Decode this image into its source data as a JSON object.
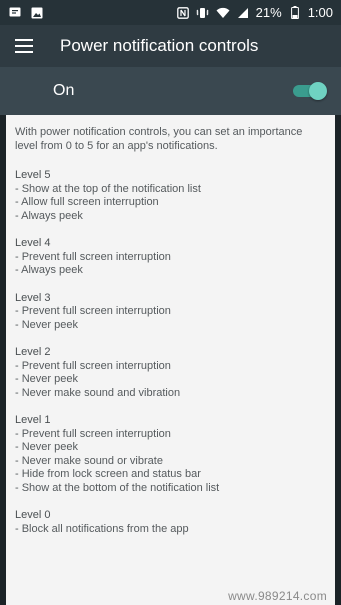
{
  "status_bar": {
    "left_icons": [
      "message-icon",
      "image-icon"
    ],
    "right_icons": [
      "nfc-icon",
      "vibrate-icon",
      "wifi-icon",
      "signal-icon",
      "battery-icon"
    ],
    "battery": "21%",
    "time": "1:00"
  },
  "app_bar": {
    "title": "Power notification controls",
    "menu_icon": "hamburger-menu-icon"
  },
  "master_switch": {
    "label": "On",
    "state": "on",
    "accent_color": "#6fd2c2"
  },
  "content": {
    "intro": "With power notification controls, you can set an importance level from 0 to 5 for an app's notifications.",
    "levels": [
      {
        "title": "Level 5",
        "items": [
          "- Show at the top of the notification list",
          "- Allow full screen interruption",
          "- Always peek"
        ]
      },
      {
        "title": "Level 4",
        "items": [
          "- Prevent full screen interruption",
          "- Always peek"
        ]
      },
      {
        "title": "Level 3",
        "items": [
          "- Prevent full screen interruption",
          "- Never peek"
        ]
      },
      {
        "title": "Level 2",
        "items": [
          "- Prevent full screen interruption",
          "- Never peek",
          "- Never make sound and vibration"
        ]
      },
      {
        "title": "Level 1",
        "items": [
          "- Prevent full screen interruption",
          "- Never peek",
          "- Never make sound or vibrate",
          "- Hide from lock screen and status bar",
          "- Show at the bottom of the notification list"
        ]
      },
      {
        "title": "Level 0",
        "items": [
          "- Block all notifications from the app"
        ]
      }
    ]
  },
  "watermark": "www.989214.com"
}
